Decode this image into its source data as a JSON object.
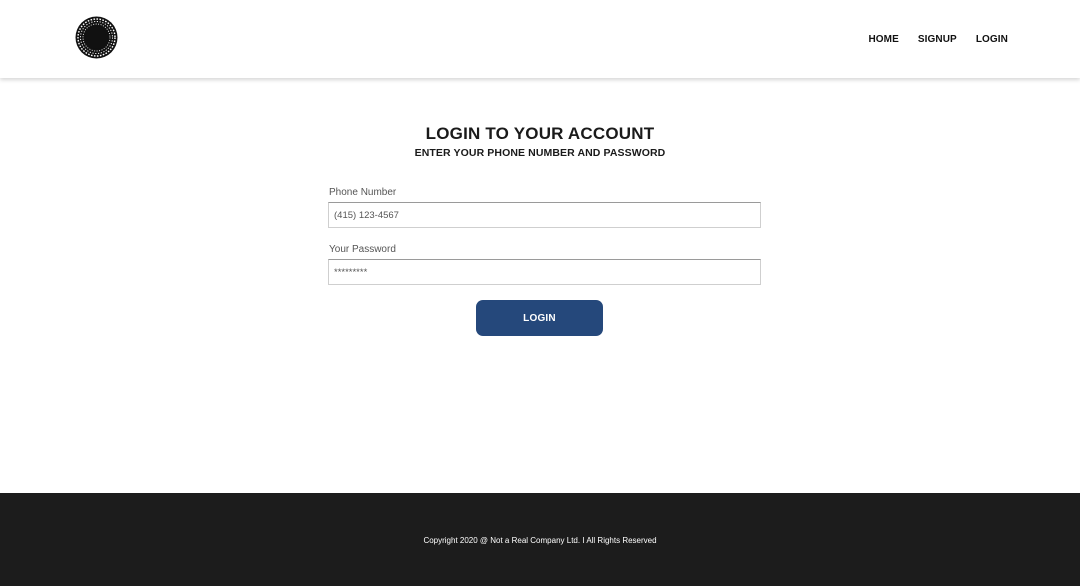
{
  "header": {
    "logo_icon": "circular-seal-logo",
    "nav": [
      {
        "label": "HOME"
      },
      {
        "label": "SIGNUP"
      },
      {
        "label": "LOGIN"
      }
    ]
  },
  "login": {
    "title": "LOGIN TO YOUR ACCOUNT",
    "subtitle": "ENTER YOUR PHONE NUMBER AND PASSWORD",
    "phone": {
      "label": "Phone Number",
      "placeholder": "(415) 123-4567"
    },
    "password": {
      "label": "Your Password",
      "placeholder": "*********"
    },
    "button_label": "LOGIN"
  },
  "footer": {
    "copyright": "Copyright 2020 @ Not a Real Company Ltd. I All Rights Reserved"
  },
  "colors": {
    "button": "#25487b",
    "footer_bg": "#1c1c1c",
    "text": "#1a1a1a"
  }
}
